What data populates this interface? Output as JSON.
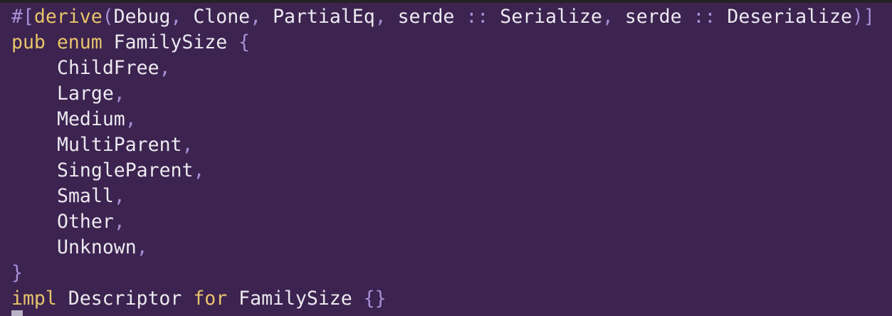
{
  "code": {
    "line1": {
      "hash_open": "#[",
      "derive": "derive",
      "paren_open": "(",
      "debug": "Debug",
      "c1": ",",
      "clone": "Clone",
      "c2": ",",
      "partialeq": "PartialEq",
      "c3": ",",
      "serde1": "serde",
      "sep1": "::",
      "serialize": "Serialize",
      "c4": ",",
      "serde2": "serde",
      "sep2": "::",
      "deserialize": "Deserialize",
      "close": ")]"
    },
    "line2": {
      "pub": "pub",
      "enum": "enum",
      "name": "FamilySize",
      "brace": "{"
    },
    "variants": [
      {
        "name": "ChildFree",
        "comma": ","
      },
      {
        "name": "Large",
        "comma": ","
      },
      {
        "name": "Medium",
        "comma": ","
      },
      {
        "name": "MultiParent",
        "comma": ","
      },
      {
        "name": "SingleParent",
        "comma": ","
      },
      {
        "name": "Small",
        "comma": ","
      },
      {
        "name": "Other",
        "comma": ","
      },
      {
        "name": "Unknown",
        "comma": ","
      }
    ],
    "close_brace": "}",
    "impl_line": {
      "impl": "impl",
      "trait": "Descriptor",
      "for": "for",
      "type": "FamilySize",
      "braces": "{}"
    }
  }
}
